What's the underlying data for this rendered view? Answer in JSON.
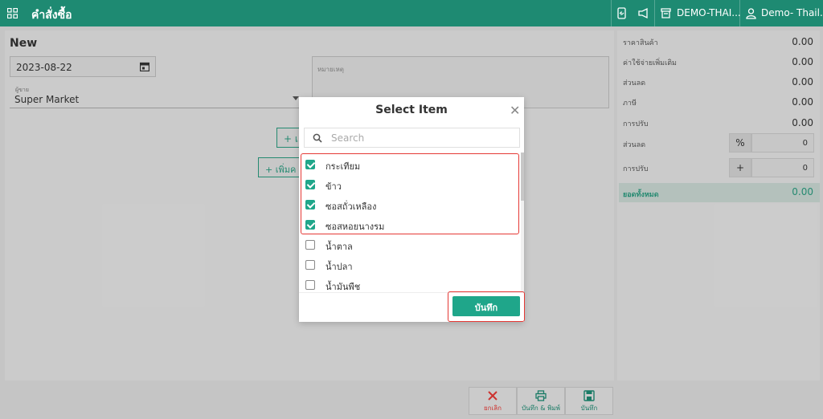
{
  "header": {
    "title": "คำสั่งซื้อ",
    "branch": "DEMO-THAI...",
    "user": "Demo- Thail..."
  },
  "form": {
    "mode": "New",
    "date": "2023-08-22",
    "vendor_caption": "ผู้ขาย",
    "vendor": "Super Market",
    "note_placeholder": "หมายเหตุ",
    "add_btn1": "+ เ",
    "add_btn2": "+ เพิ่มค"
  },
  "summary": {
    "rows": [
      {
        "label": "ราคาสินค้า",
        "value": "0.00"
      },
      {
        "label": "ค่าใช้จ่ายเพิ่มเติม",
        "value": "0.00"
      },
      {
        "label": "ส่วนลด",
        "value": "0.00"
      },
      {
        "label": "ภาษี",
        "value": "0.00"
      },
      {
        "label": "การปรับ",
        "value": "0.00"
      }
    ],
    "discount_label": "ส่วนลด",
    "discount_symbol": "%",
    "discount_value": "0",
    "adjust_label": "การปรับ",
    "adjust_symbol": "+",
    "adjust_value": "0",
    "total_label": "ยอดทั้งหมด",
    "total_value": "0.00"
  },
  "toolbar": {
    "cancel": "ยกเลิก",
    "save_print": "บันทึก & พิมพ์",
    "save": "บันทึก"
  },
  "modal": {
    "title": "Select Item",
    "search_placeholder": "Search",
    "items": [
      {
        "label": "กระเทียม",
        "checked": true
      },
      {
        "label": "ข้าว",
        "checked": true
      },
      {
        "label": "ซอสถั่วเหลือง",
        "checked": true
      },
      {
        "label": "ซอสหอยนางรม",
        "checked": true
      },
      {
        "label": "น้ำตาล",
        "checked": false
      },
      {
        "label": "น้ำปลา",
        "checked": false
      },
      {
        "label": "น้ำมันพืช",
        "checked": false
      }
    ],
    "save_label": "บันทึก"
  },
  "colors": {
    "brand": "#1e8a72",
    "accent": "#1fa68a",
    "highlight": "#e53935"
  }
}
